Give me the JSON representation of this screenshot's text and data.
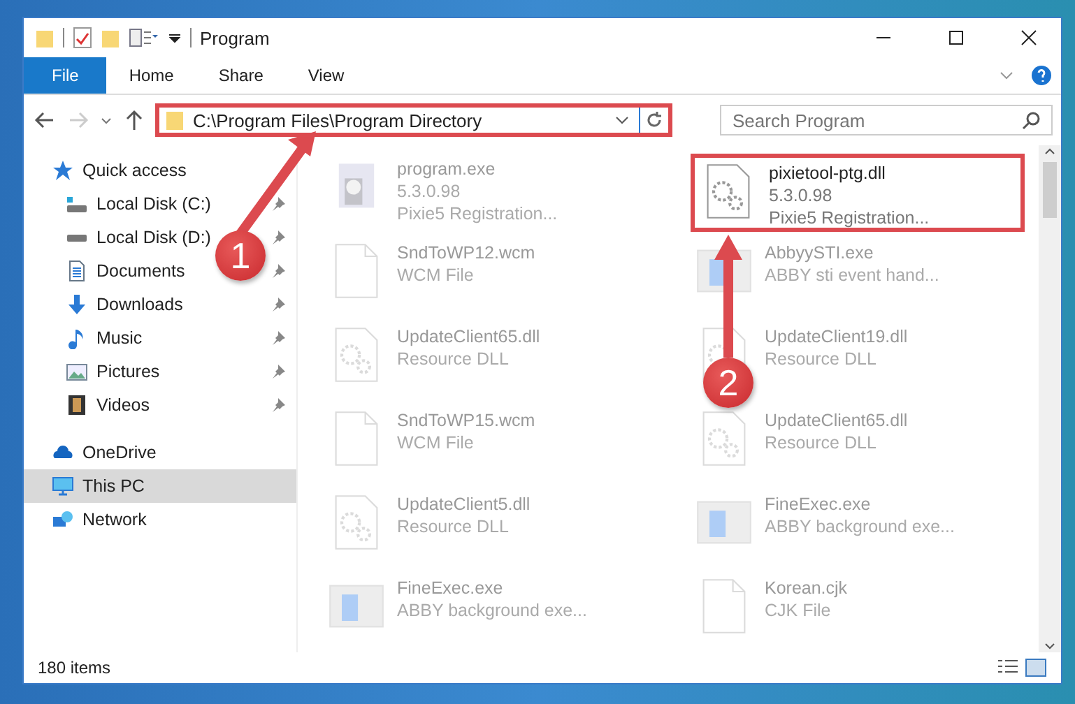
{
  "window": {
    "title": "Program"
  },
  "ribbon_tabs": [
    {
      "label": "File",
      "selected": true
    },
    {
      "label": "Home",
      "selected": false
    },
    {
      "label": "Share",
      "selected": false
    },
    {
      "label": "View",
      "selected": false
    }
  ],
  "address_bar": {
    "path": "C:\\Program Files\\Program Directory",
    "highlighted": true
  },
  "search": {
    "placeholder": "Search Program"
  },
  "sidebar": {
    "items": [
      {
        "label": "Quick access",
        "kind": "quick",
        "selected": false,
        "children": [
          {
            "label": "Local Disk (C:)",
            "kind": "disk-c",
            "pinned": true
          },
          {
            "label": "Local Disk (D:)",
            "kind": "disk",
            "pinned": true
          },
          {
            "label": "Documents",
            "kind": "documents",
            "pinned": true
          },
          {
            "label": "Downloads",
            "kind": "downloads",
            "pinned": true
          },
          {
            "label": "Music",
            "kind": "music",
            "pinned": true
          },
          {
            "label": "Pictures",
            "kind": "pictures",
            "pinned": true
          },
          {
            "label": "Videos",
            "kind": "videos",
            "pinned": true
          }
        ]
      },
      {
        "label": "OneDrive",
        "kind": "cloud",
        "selected": false
      },
      {
        "label": "This PC",
        "kind": "pc",
        "selected": true
      },
      {
        "label": "Network",
        "kind": "network",
        "selected": false
      }
    ]
  },
  "files": [
    {
      "name": "program.exe",
      "details": [
        "5.3.0.98",
        "Pixie5 Registration..."
      ],
      "kind": "installer",
      "dimmed": true,
      "highlighted": false
    },
    {
      "name": "pixietool-ptg.dll",
      "details": [
        "5.3.0.98",
        "Pixie5 Registration..."
      ],
      "kind": "dll",
      "dimmed": false,
      "highlighted": true
    },
    {
      "name": "SndToWP12.wcm",
      "details": [
        "WCM File"
      ],
      "kind": "doc",
      "dimmed": true,
      "highlighted": false
    },
    {
      "name": "AbbyySTI.exe",
      "details": [
        "ABBY sti event hand..."
      ],
      "kind": "exe",
      "dimmed": true,
      "highlighted": false
    },
    {
      "name": "UpdateClient65.dll",
      "details": [
        "Resource DLL"
      ],
      "kind": "dll",
      "dimmed": true,
      "highlighted": false
    },
    {
      "name": "UpdateClient19.dll",
      "details": [
        "Resource DLL"
      ],
      "kind": "dll",
      "dimmed": true,
      "highlighted": false
    },
    {
      "name": "SndToWP15.wcm",
      "details": [
        "WCM File"
      ],
      "kind": "doc",
      "dimmed": true,
      "highlighted": false
    },
    {
      "name": "UpdateClient65.dll",
      "details": [
        "Resource DLL"
      ],
      "kind": "dll",
      "dimmed": true,
      "highlighted": false
    },
    {
      "name": "UpdateClient5.dll",
      "details": [
        "Resource DLL"
      ],
      "kind": "dll",
      "dimmed": true,
      "highlighted": false
    },
    {
      "name": "FineExec.exe",
      "details": [
        "ABBY background exe..."
      ],
      "kind": "exe",
      "dimmed": true,
      "highlighted": false
    },
    {
      "name": "FineExec.exe",
      "details": [
        "ABBY background exe..."
      ],
      "kind": "exe",
      "dimmed": true,
      "highlighted": false
    },
    {
      "name": "Korean.cjk",
      "details": [
        "CJK File"
      ],
      "kind": "doc",
      "dimmed": true,
      "highlighted": false
    }
  ],
  "status_bar": {
    "item_count": "180 items"
  },
  "annotations": [
    {
      "label": "1"
    },
    {
      "label": "2"
    }
  ]
}
